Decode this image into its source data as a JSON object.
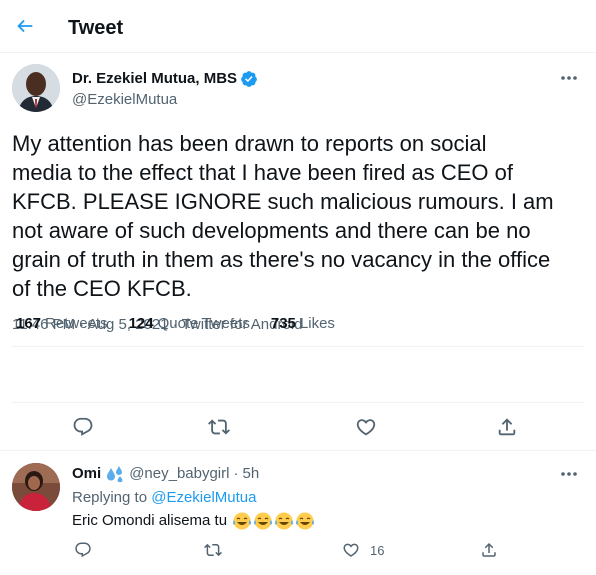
{
  "header": {
    "title": "Tweet"
  },
  "tweet": {
    "author_name": "Dr. Ezekiel Mutua, MBS",
    "author_handle": "@EzekielMutua",
    "text": "My attention has been drawn to reports on social\nmedia to the effect that I have been fired as CEO of\nKFCB. PLEASE IGNORE such malicious rumours. I am\nnot aware of such developments and there can be no\ngrain of truth in them as there's no vacancy in the office\nof the CEO KFCB.",
    "time": "11:46 PM",
    "date": "Aug 5, 2021",
    "separator": "·",
    "source": "Twitter for Android",
    "stats": {
      "retweets_count": "167",
      "retweets_label": "Retweets",
      "quotes_count": "124",
      "quotes_label": "Quote Tweets",
      "likes_count": "735",
      "likes_label": "Likes"
    }
  },
  "reply": {
    "name": "Omi",
    "handle": "@ney_babygirl",
    "dot": "·",
    "time": "5h",
    "replying_prefix": "Replying to",
    "replying_to": "@EzekielMutua",
    "text": "Eric Omondi alisema tu",
    "emoji": [
      "laughing-tears",
      "laughing-tears",
      "laughing-tears",
      "laughing-tears"
    ],
    "like_count": "16"
  },
  "colors": {
    "accent": "#1d9bf0",
    "text": "#0f1419",
    "secondary": "#536471",
    "border": "#eff3f4"
  }
}
